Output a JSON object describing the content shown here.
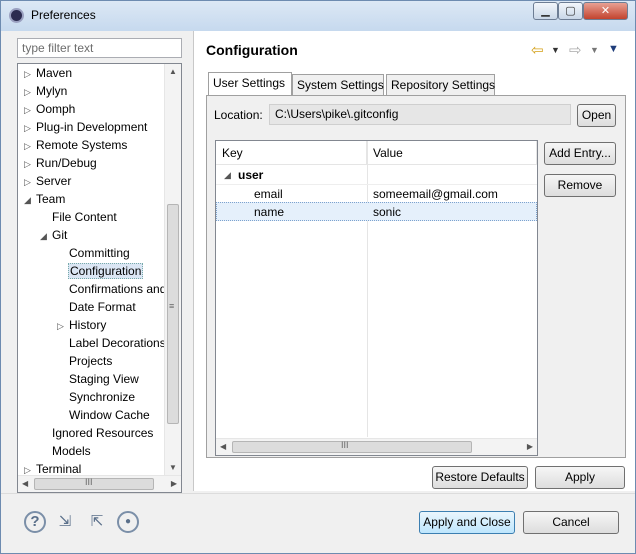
{
  "window": {
    "title": "Preferences"
  },
  "filter": {
    "placeholder": "type filter text"
  },
  "tree": {
    "items": [
      {
        "label": "Maven"
      },
      {
        "label": "Mylyn"
      },
      {
        "label": "Oomph"
      },
      {
        "label": "Plug-in Development"
      },
      {
        "label": "Remote Systems"
      },
      {
        "label": "Run/Debug"
      },
      {
        "label": "Server"
      },
      {
        "label": "Team"
      },
      {
        "label": "File Content"
      },
      {
        "label": "Git"
      },
      {
        "label": "Committing"
      },
      {
        "label": "Configuration"
      },
      {
        "label": "Confirmations and"
      },
      {
        "label": "Date Format"
      },
      {
        "label": "History"
      },
      {
        "label": "Label Decorations"
      },
      {
        "label": "Projects"
      },
      {
        "label": "Staging View"
      },
      {
        "label": "Synchronize"
      },
      {
        "label": "Window Cache"
      },
      {
        "label": "Ignored Resources"
      },
      {
        "label": "Models"
      },
      {
        "label": "Terminal"
      }
    ],
    "hscroll_label": "III",
    "vscroll_label": "≡"
  },
  "page": {
    "title": "Configuration"
  },
  "tabs": [
    {
      "label": "User Settings"
    },
    {
      "label": "System Settings"
    },
    {
      "label": "Repository Settings"
    }
  ],
  "location": {
    "label": "Location:",
    "value": "C:\\Users\\pike\\.gitconfig",
    "open_label": "Open"
  },
  "table": {
    "columns": [
      "Key",
      "Value"
    ],
    "section": "user",
    "rows": [
      {
        "key": "email",
        "value": "someemail@gmail.com"
      },
      {
        "key": "name",
        "value": "sonic"
      }
    ],
    "hscroll_label": "III"
  },
  "actions": {
    "add_entry": "Add Entry...",
    "remove": "Remove",
    "restore_defaults": "Restore Defaults",
    "apply": "Apply",
    "apply_and_close": "Apply and Close",
    "cancel": "Cancel"
  },
  "icons": {
    "back": "back-arrow-icon",
    "forward": "forward-arrow-icon",
    "menu": "view-menu-icon",
    "help": "help-icon",
    "import": "import-icon",
    "export": "export-icon",
    "record": "record-icon"
  }
}
